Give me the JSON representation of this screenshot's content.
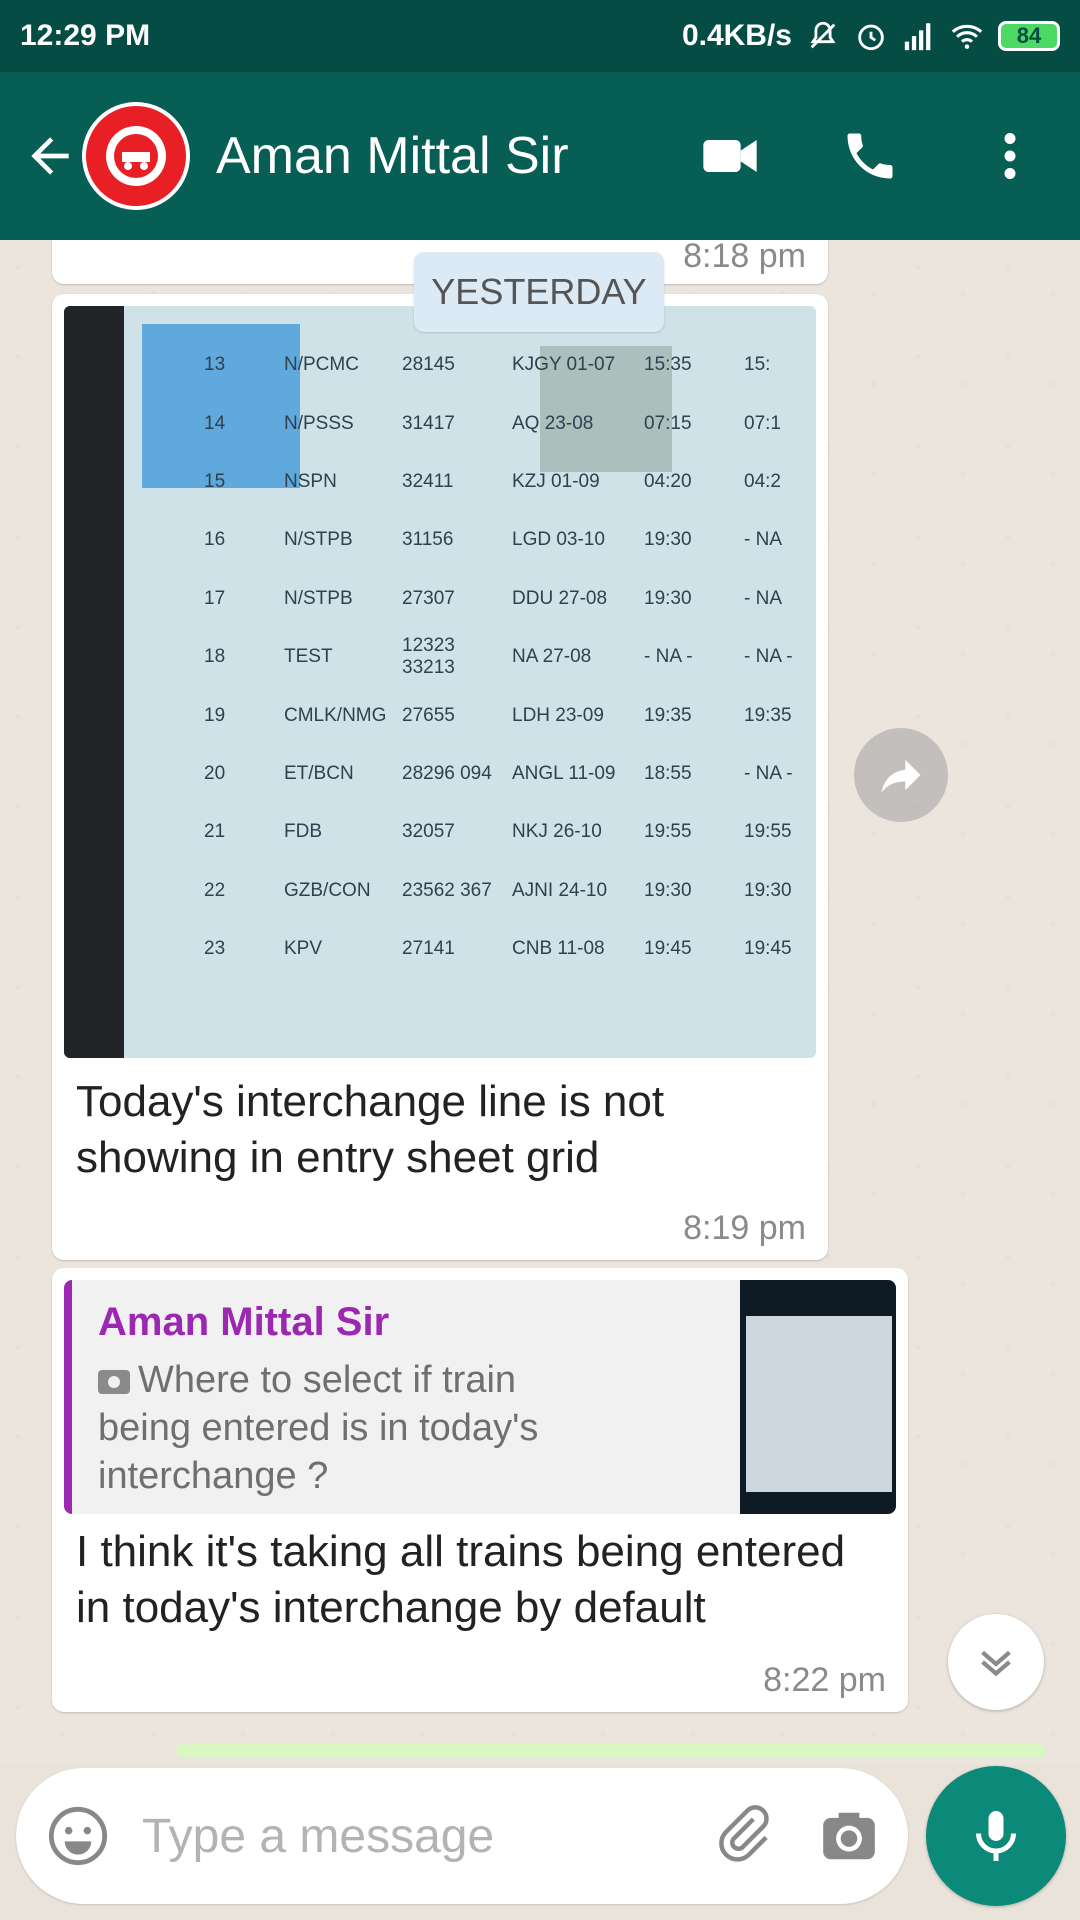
{
  "status_bar": {
    "time": "12:29 PM",
    "network_speed": "0.4KB/s",
    "battery": "84"
  },
  "header": {
    "contact_name": "Aman Mittal Sir"
  },
  "chat": {
    "prev_message_time": "8:18 pm",
    "date_chip": "YESTERDAY",
    "image_message": {
      "caption": "Today's interchange line is not showing in entry sheet grid",
      "time": "8:19 pm",
      "photo_rows": [
        [
          "13",
          "N/PCMC",
          "28145",
          "KJGY 01-07",
          "15:35",
          "15:"
        ],
        [
          "14",
          "N/PSSS",
          "31417",
          "AQ 23-08",
          "07:15",
          "07:1"
        ],
        [
          "15",
          "NSPN",
          "32411",
          "KZJ 01-09",
          "04:20",
          "04:2"
        ],
        [
          "16",
          "N/STPB",
          "31156",
          "LGD 03-10",
          "19:30",
          "- NA"
        ],
        [
          "17",
          "N/STPB",
          "27307",
          "DDU 27-08",
          "19:30",
          "- NA"
        ],
        [
          "18",
          "TEST",
          "12323 33213",
          "NA 27-08",
          "- NA -",
          "- NA -"
        ],
        [
          "19",
          "CMLK/NMG",
          "27655",
          "LDH 23-09",
          "19:35",
          "19:35"
        ],
        [
          "20",
          "ET/BCN",
          "28296 094",
          "ANGL 11-09",
          "18:55",
          "- NA -"
        ],
        [
          "21",
          "FDB",
          "32057",
          "NKJ 26-10",
          "19:55",
          "19:55"
        ],
        [
          "22",
          "GZB/CON",
          "23562 367",
          "AJNI 24-10",
          "19:30",
          "19:30"
        ],
        [
          "23",
          "KPV",
          "27141",
          "CNB 11-08",
          "19:45",
          "19:45"
        ]
      ]
    },
    "reply_message": {
      "quoted_name": "Aman Mittal Sir",
      "quoted_text": "Where to select if train being entered is in today's interchange ?",
      "text": "I think it's taking all trains being entered in today's interchange by default",
      "time": "8:22 pm"
    }
  },
  "input": {
    "placeholder": "Type a message"
  },
  "colors": {
    "header": "#075e54",
    "status_bar": "#054d44",
    "accent": "#0b8a7a",
    "quote_accent": "#9c27b0"
  },
  "icons": [
    "back-arrow-icon",
    "railways-logo",
    "video-call-icon",
    "phone-icon",
    "more-vert-icon",
    "forward-icon",
    "scroll-down-icon",
    "emoji-icon",
    "attach-icon",
    "camera-icon",
    "mic-icon"
  ]
}
